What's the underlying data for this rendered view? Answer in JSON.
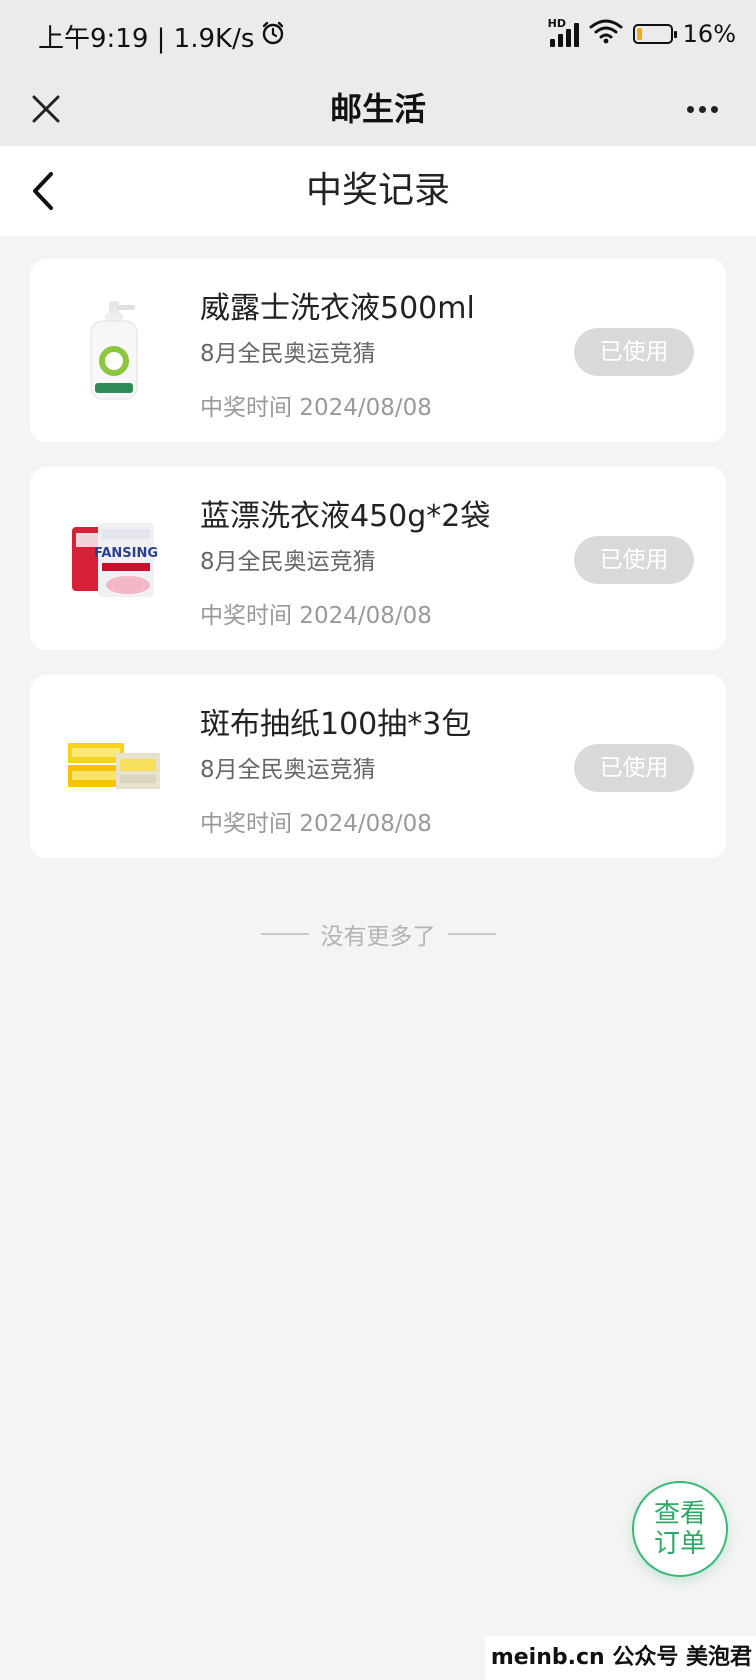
{
  "status_bar": {
    "time_text": "上午9:19 | 1.9K/s",
    "alarm_icon": "alarm-clock-icon",
    "hd_label": "HD",
    "battery_text": "16%",
    "battery_level": 0.16,
    "battery_color": "#f1a81b"
  },
  "app_header": {
    "title": "邮生活"
  },
  "page_header": {
    "title": "中奖记录"
  },
  "records": [
    {
      "title": "威露士洗衣液500ml",
      "subtitle": "8月全民奥运竞猜",
      "time": "中奖时间 2024/08/08",
      "button": "已使用",
      "image": "laundry-bottle-image"
    },
    {
      "title": "蓝漂洗衣液450g*2袋",
      "subtitle": "8月全民奥运竞猜",
      "time": "中奖时间 2024/08/08",
      "button": "已使用",
      "image": "laundry-pouch-image"
    },
    {
      "title": "斑布抽纸100抽*3包",
      "subtitle": "8月全民奥运竞猜",
      "time": "中奖时间 2024/08/08",
      "button": "已使用",
      "image": "tissue-pack-image"
    }
  ],
  "footer": {
    "no_more": "没有更多了"
  },
  "fab": {
    "line1": "查看",
    "line2": "订单",
    "color": "#2fa866"
  },
  "watermark": "meinb.cn  公众号 美泡君"
}
